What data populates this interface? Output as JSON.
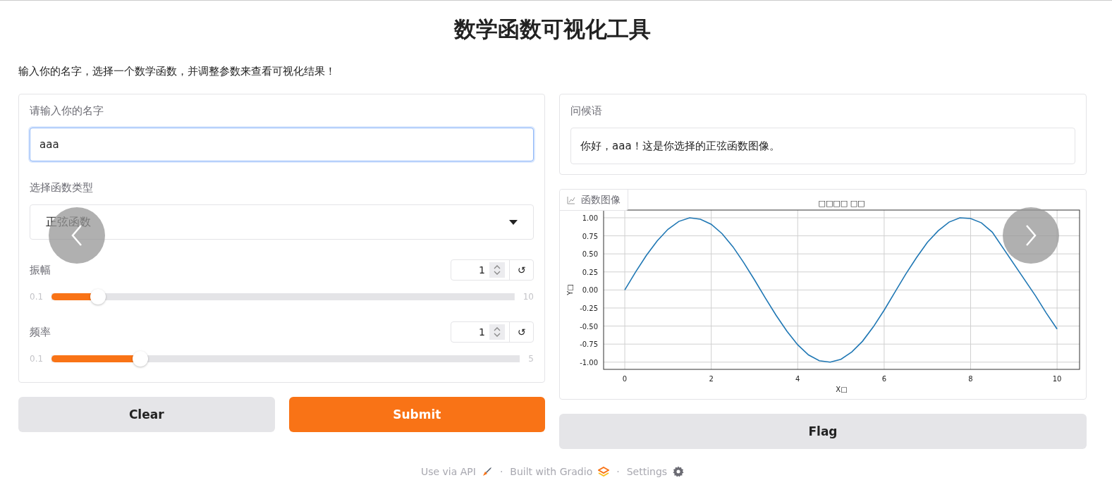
{
  "title": "数学函数可视化工具",
  "description": "输入你的名字，选择一个数学函数，并调整参数来查看可视化结果！",
  "inputs": {
    "name_field": {
      "label": "请输入你的名字",
      "value": "aaa"
    },
    "function_dropdown": {
      "label": "选择函数类型",
      "value": "正弦函数"
    },
    "sliders": [
      {
        "label": "振幅",
        "value": "1",
        "reset": "↺",
        "min": "0.1",
        "max": "10",
        "level": 0.1
      },
      {
        "label": "频率",
        "value": "1",
        "reset": "↺",
        "min": "0.1",
        "max": "5",
        "level": 0.19
      }
    ]
  },
  "buttons": [
    {
      "label": "Clear",
      "kind": "secondary"
    },
    {
      "label": "Submit",
      "kind": "primary"
    }
  ],
  "outputs": {
    "greeting": {
      "label": "问候语",
      "value": "你好，aaa！这是你选择的正弦函数图像。"
    },
    "plot": {
      "label": "函数图像",
      "chart_data": {
        "type": "line",
        "title": "□□□□ □□",
        "xlabel": "X□",
        "ylabel": "Y□",
        "grid": true,
        "x": [
          0,
          0.25,
          0.5,
          0.75,
          1,
          1.25,
          1.5,
          1.75,
          2,
          2.25,
          2.5,
          2.75,
          3,
          3.25,
          3.5,
          3.75,
          4,
          4.25,
          4.5,
          4.75,
          5,
          5.25,
          5.5,
          5.75,
          6,
          6.25,
          6.5,
          6.75,
          7,
          7.25,
          7.5,
          7.75,
          8,
          8.25,
          8.5,
          9.5,
          9.75,
          10
        ],
        "series": [
          {
            "color": "#1f77b4",
            "values": [
              0,
              0.25,
              0.48,
              0.68,
              0.84,
              0.95,
              1,
              0.98,
              0.91,
              0.78,
              0.6,
              0.38,
              0.14,
              -0.11,
              -0.35,
              -0.57,
              -0.76,
              -0.9,
              -0.98,
              -1,
              -0.96,
              -0.86,
              -0.71,
              -0.51,
              -0.28,
              -0.03,
              0.22,
              0.45,
              0.66,
              0.82,
              0.94,
              1,
              0.99,
              0.93,
              0.8,
              -0.08,
              -0.32,
              -0.54
            ]
          }
        ],
        "xlim": [
          -0.49,
          10.52
        ],
        "ylim": [
          -1.1,
          1.107
        ],
        "xticks": [
          0,
          2,
          4,
          6,
          8,
          10
        ],
        "yticks": [
          {
            "value": -1,
            "label": "-1.00"
          },
          {
            "value": -0.75,
            "label": "-0.75"
          },
          {
            "value": -0.5,
            "label": "-0.50"
          },
          {
            "value": -0.25,
            "label": "-0.25"
          },
          {
            "value": 0,
            "label": "0.00"
          },
          {
            "value": 0.25,
            "label": "0.25"
          },
          {
            "value": 0.5,
            "label": "0.50"
          },
          {
            "value": 0.75,
            "label": "0.75"
          },
          {
            "value": 1,
            "label": "1.00"
          }
        ]
      }
    },
    "flag_button": {
      "label": "Flag"
    }
  },
  "footer": {
    "separator": "·",
    "links": [
      {
        "label": "Use via API",
        "kind": "api"
      },
      {
        "label": "Built with Gradio",
        "kind": "gradio"
      },
      {
        "label": "Settings",
        "kind": "settings"
      }
    ]
  }
}
